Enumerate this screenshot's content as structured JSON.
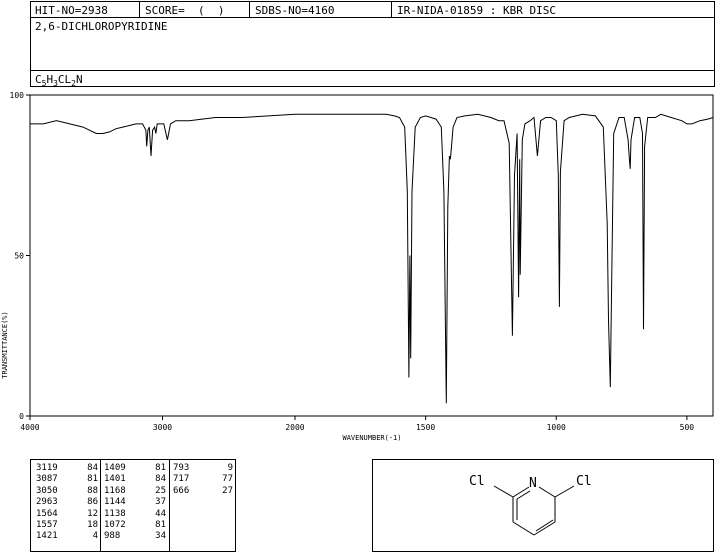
{
  "header": {
    "hit_no": "HIT-NO=2938",
    "score": "SCORE=  (  )",
    "sdbs_no": "SDBS-NO=4160",
    "ir_id": "IR-NIDA-01859 : KBR DISC"
  },
  "compound_name": "2,6-DICHLOROPYRIDINE",
  "formula": {
    "parts": [
      "C",
      "5",
      "H",
      "3",
      "CL",
      "2",
      "N"
    ]
  },
  "chart_data": {
    "type": "line",
    "xlabel": "WAVENUMBER(-1)",
    "ylabel": "TRANSMITTANCE(%)",
    "xlim": [
      4000,
      400
    ],
    "ylim": [
      0,
      100
    ],
    "x_ticks": [
      "4000",
      "3000",
      "2000",
      "1500",
      "1000",
      "500"
    ],
    "y_ticks": [
      "100",
      "50",
      "0"
    ],
    "x_tick_values": [
      4000,
      3000,
      2000,
      1500,
      1000,
      500
    ],
    "y_tick_values": [
      100,
      50,
      0
    ],
    "grid": false,
    "x": [
      4000,
      3900,
      3800,
      3700,
      3600,
      3500,
      3450,
      3400,
      3350,
      3300,
      3250,
      3200,
      3150,
      3125,
      3119,
      3110,
      3100,
      3087,
      3075,
      3060,
      3050,
      3040,
      3020,
      2990,
      2963,
      2940,
      2900,
      2800,
      2600,
      2400,
      2200,
      2000,
      1800,
      1700,
      1650,
      1620,
      1600,
      1580,
      1570,
      1564,
      1560,
      1557,
      1552,
      1540,
      1520,
      1500,
      1480,
      1460,
      1440,
      1430,
      1421,
      1415,
      1409,
      1405,
      1401,
      1395,
      1380,
      1350,
      1300,
      1250,
      1220,
      1200,
      1180,
      1168,
      1160,
      1150,
      1144,
      1140,
      1138,
      1130,
      1120,
      1100,
      1085,
      1072,
      1060,
      1040,
      1020,
      1000,
      992,
      988,
      984,
      970,
      950,
      900,
      850,
      820,
      805,
      800,
      793,
      788,
      780,
      760,
      740,
      725,
      720,
      717,
      714,
      700,
      680,
      670,
      666,
      662,
      650,
      620,
      600,
      560,
      520,
      500,
      480,
      450,
      420,
      400
    ],
    "y": [
      91,
      91,
      92,
      91,
      90,
      88,
      88,
      88.5,
      89.5,
      90,
      90.5,
      91,
      91,
      89,
      84,
      89,
      90,
      81,
      89,
      90,
      88,
      91,
      91,
      91,
      86,
      91,
      92,
      92,
      93,
      93,
      93.5,
      94,
      94,
      94,
      94,
      93.5,
      93,
      90,
      70,
      12,
      50,
      18,
      70,
      90,
      93,
      93.5,
      93,
      92.5,
      90,
      70,
      4,
      65,
      81,
      80,
      84,
      90,
      93,
      93.5,
      94,
      93,
      92,
      92,
      85,
      25,
      75,
      88,
      37,
      80,
      44,
      86,
      91,
      92,
      93,
      81,
      92,
      93,
      93,
      92,
      75,
      34,
      76,
      92,
      93,
      94,
      93.5,
      90,
      60,
      30,
      9,
      40,
      88,
      93,
      93,
      86,
      80,
      77,
      86,
      93,
      93,
      88,
      27,
      84,
      93,
      93,
      94,
      93,
      92,
      91,
      91,
      92,
      92.5,
      93
    ]
  },
  "peak_table": {
    "columns": [
      [
        [
          "3119",
          "84"
        ],
        [
          "3087",
          "81"
        ],
        [
          "3050",
          "88"
        ],
        [
          "2963",
          "86"
        ],
        [
          "1564",
          "12"
        ],
        [
          "1557",
          "18"
        ],
        [
          "1421",
          "4"
        ]
      ],
      [
        [
          "1409",
          "81"
        ],
        [
          "1401",
          "84"
        ],
        [
          "1168",
          "25"
        ],
        [
          "1144",
          "37"
        ],
        [
          "1138",
          "44"
        ],
        [
          "1072",
          "81"
        ],
        [
          "988",
          "34"
        ]
      ],
      [
        [
          "793",
          "9"
        ],
        [
          "717",
          "77"
        ],
        [
          "666",
          "27"
        ]
      ]
    ]
  },
  "structure": {
    "atoms": [
      "Cl",
      "N",
      "Cl"
    ]
  }
}
